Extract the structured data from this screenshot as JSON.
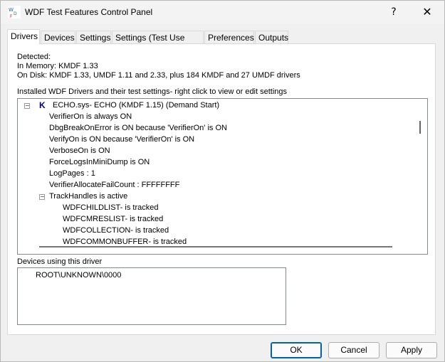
{
  "window": {
    "title": "WDF Test Features Control Panel",
    "help_glyph": "?",
    "close_glyph": "✕"
  },
  "tabs": [
    {
      "label": "Drivers",
      "active": true
    },
    {
      "label": "Devices",
      "active": false
    },
    {
      "label": "Settings",
      "active": false
    },
    {
      "label": "Settings (Test Use Only)",
      "active": false
    },
    {
      "label": "Preferences",
      "active": false
    },
    {
      "label": "Outputs",
      "active": false
    }
  ],
  "detected": {
    "heading": "Detected:",
    "memory": "In Memory: KMDF 1.33",
    "disk": "On Disk: KMDF 1.33, UMDF 1.11 and 2.33, plus 184 KMDF and 27 UMDF drivers"
  },
  "installed": {
    "label": "Installed WDF Drivers and their test settings- right click to view or edit settings",
    "driver_icon": "K",
    "expander_glyph": "−",
    "driver": "ECHO.sys- ECHO (KMDF 1.15) (Demand Start)",
    "settings": [
      "VerifierOn is always ON",
      "DbgBreakOnError is ON because 'VerifierOn' is ON",
      "VerifyOn is ON because 'VerifierOn' is ON",
      "VerboseOn is ON",
      "ForceLogsInMiniDump is ON",
      "LogPages : 1",
      "VerifierAllocateFailCount : FFFFFFFF"
    ],
    "track_handles": "TrackHandles is active",
    "tracked": [
      "WDFCHILDLIST- is tracked",
      "WDFCMRESLIST- is tracked",
      "WDFCOLLECTION- is tracked",
      "WDFCOMMONBUFFER- is tracked"
    ]
  },
  "devices": {
    "label": "Devices using this driver",
    "items": [
      "ROOT\\UNKNOWN\\0000"
    ]
  },
  "buttons": {
    "ok": "OK",
    "cancel": "Cancel",
    "apply": "Apply"
  }
}
